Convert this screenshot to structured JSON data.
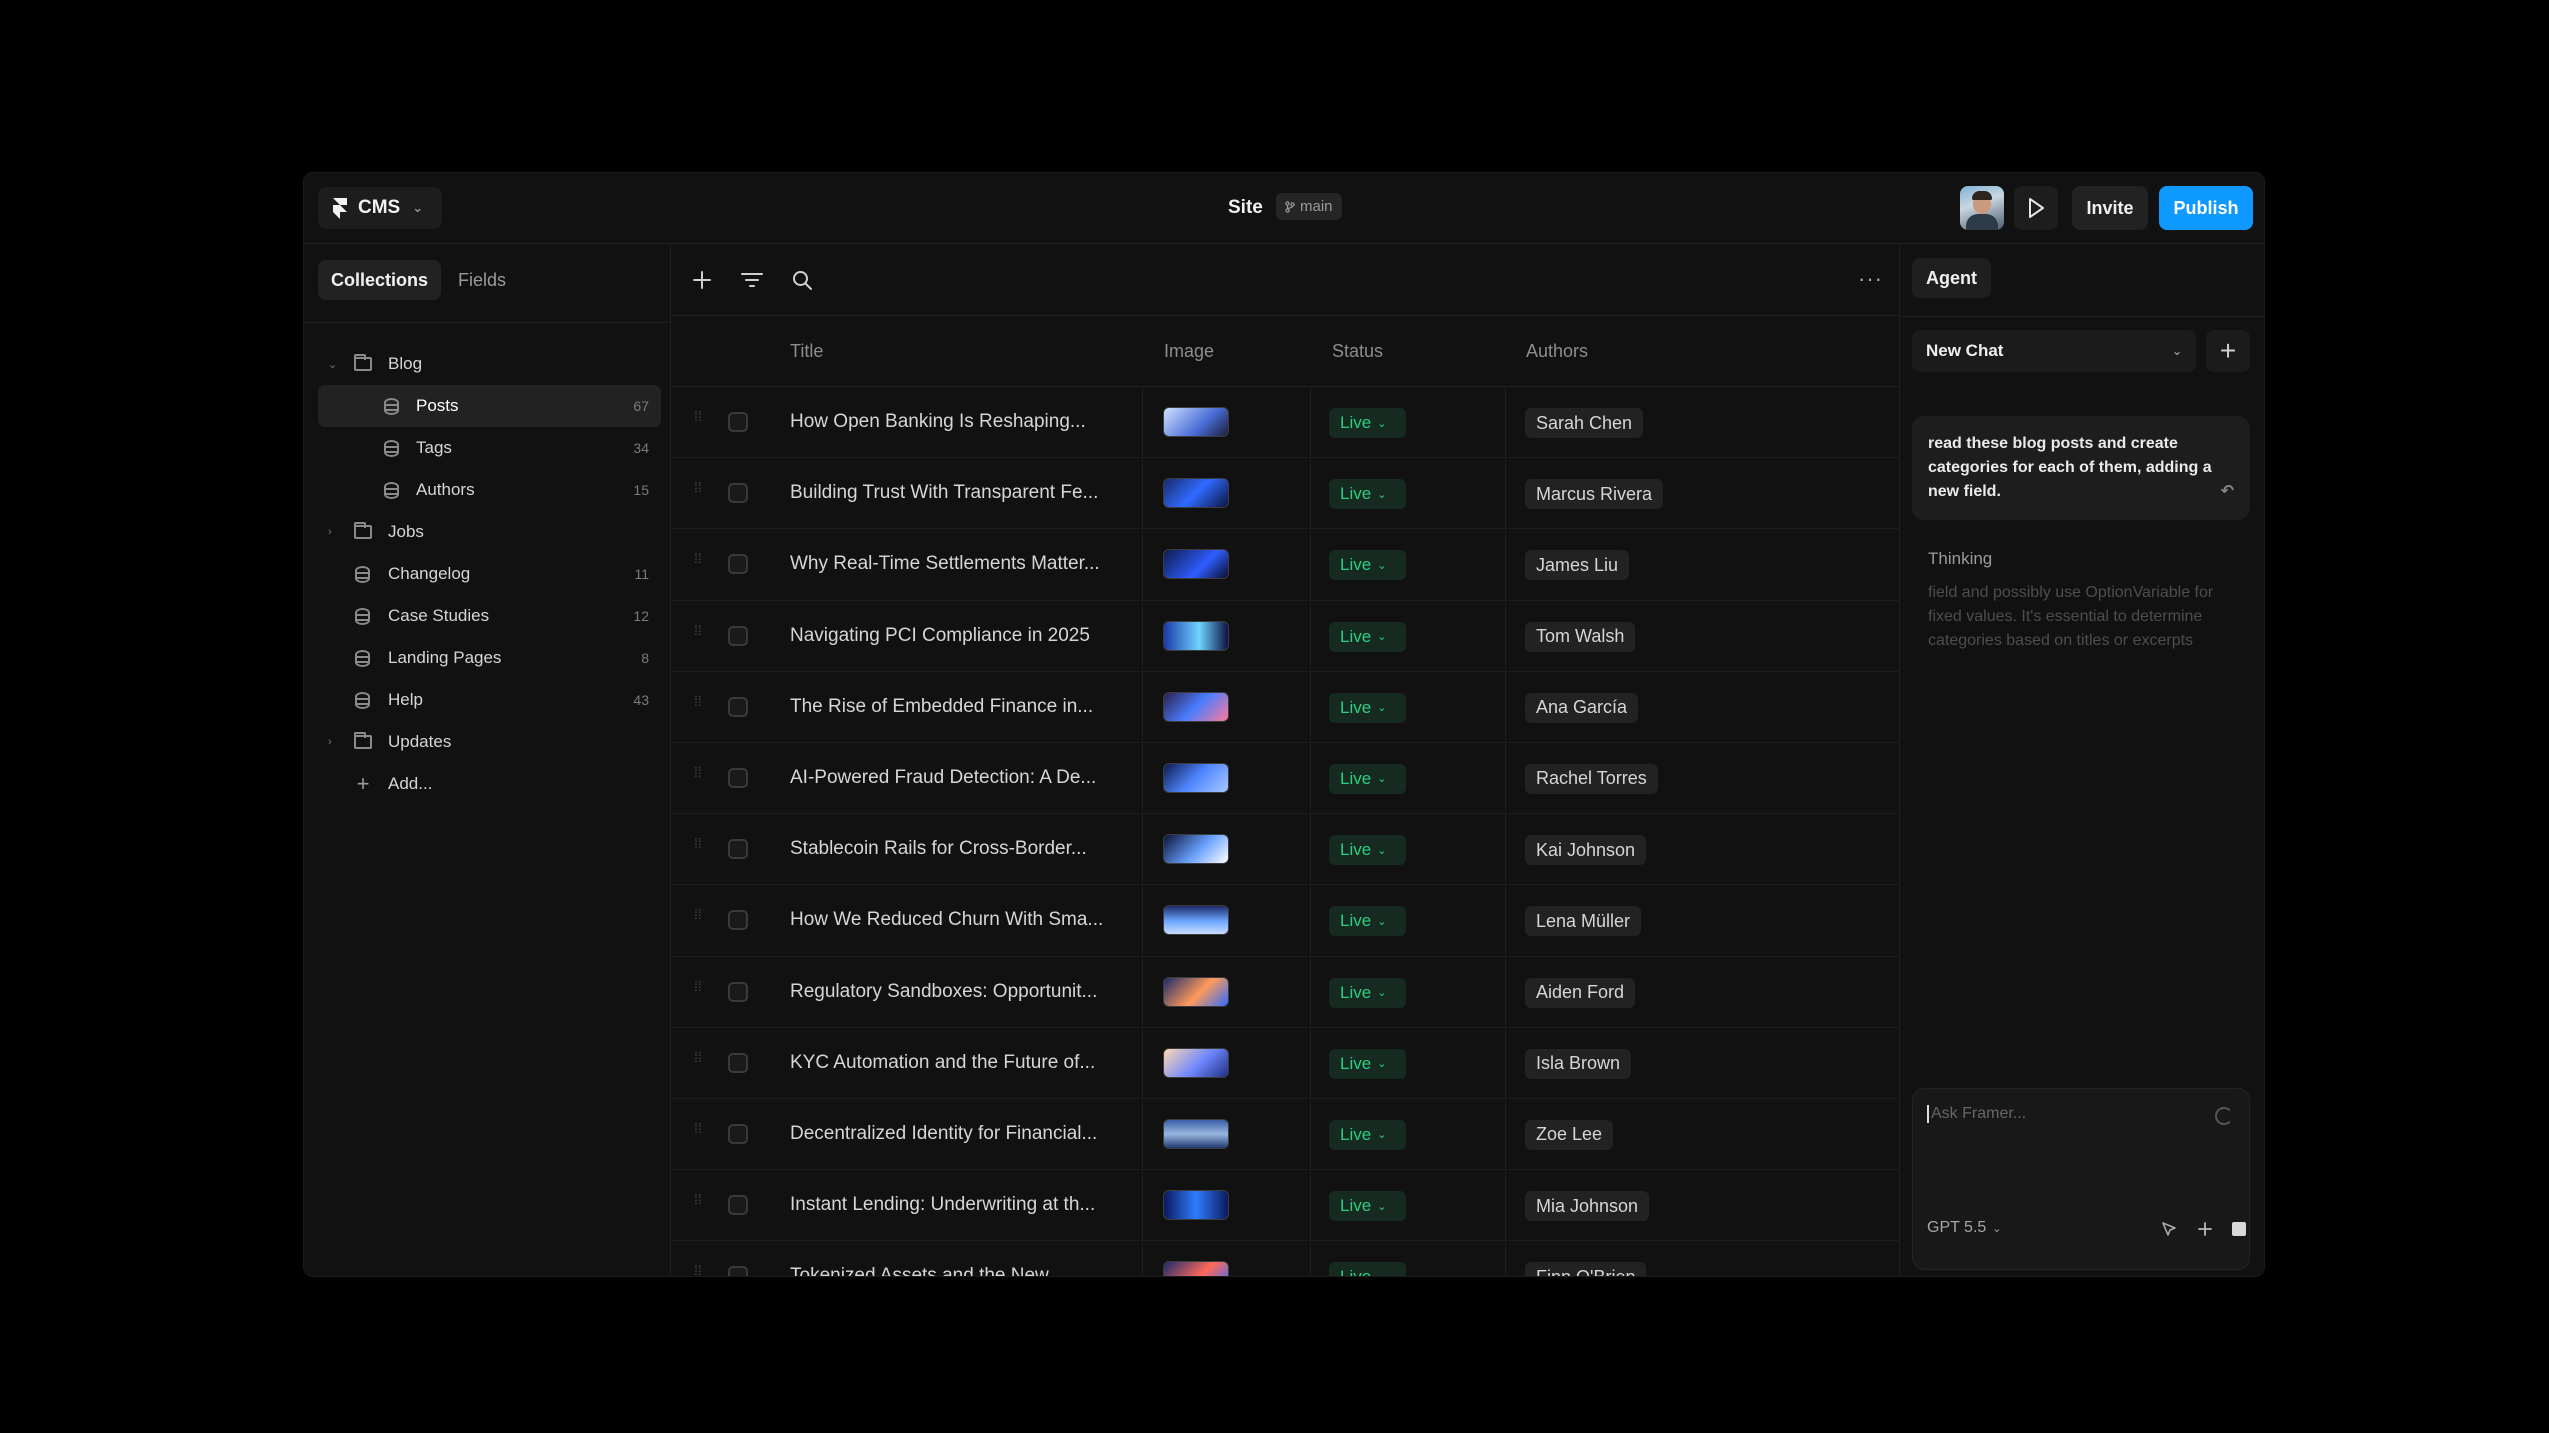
{
  "topbar": {
    "app_label": "CMS",
    "site_title": "Site",
    "branch": "main",
    "invite_label": "Invite",
    "publish_label": "Publish",
    "accent_color": "#0d99ff"
  },
  "sidebar": {
    "tabs": [
      "Collections",
      "Fields"
    ],
    "items": [
      {
        "label": "Blog",
        "count": "",
        "icon": "folder-icon"
      },
      {
        "label": "Posts",
        "count": "67",
        "icon": "database-icon"
      },
      {
        "label": "Tags",
        "count": "34",
        "icon": "database-icon"
      },
      {
        "label": "Authors",
        "count": "15",
        "icon": "database-icon"
      },
      {
        "label": "Jobs",
        "count": "",
        "icon": "folder-icon"
      },
      {
        "label": "Changelog",
        "count": "11",
        "icon": "database-icon"
      },
      {
        "label": "Case Studies",
        "count": "12",
        "icon": "database-icon"
      },
      {
        "label": "Landing Pages",
        "count": "8",
        "icon": "database-icon"
      },
      {
        "label": "Help",
        "count": "43",
        "icon": "database-icon"
      },
      {
        "label": "Updates",
        "count": "",
        "icon": "folder-icon"
      },
      {
        "label": "Add...",
        "count": "",
        "icon": "plus-icon"
      }
    ]
  },
  "table": {
    "columns": [
      "Title",
      "Image",
      "Status",
      "Authors"
    ],
    "status_color": "#2bd07f",
    "rows": [
      {
        "title": "How Open Banking Is Reshaping...",
        "status": "Live",
        "author": "Sarah Chen"
      },
      {
        "title": "Building Trust With Transparent Fe...",
        "status": "Live",
        "author": "Marcus Rivera"
      },
      {
        "title": "Why Real-Time Settlements Matter...",
        "status": "Live",
        "author": "James Liu"
      },
      {
        "title": "Navigating PCI Compliance in 2025",
        "status": "Live",
        "author": "Tom Walsh"
      },
      {
        "title": "The Rise of Embedded Finance in...",
        "status": "Live",
        "author": "Ana García"
      },
      {
        "title": "AI-Powered Fraud Detection: A De...",
        "status": "Live",
        "author": "Rachel Torres"
      },
      {
        "title": "Stablecoin Rails for Cross-Border...",
        "status": "Live",
        "author": "Kai Johnson"
      },
      {
        "title": "How We Reduced Churn With Sma...",
        "status": "Live",
        "author": "Lena Müller"
      },
      {
        "title": "Regulatory Sandboxes: Opportunit...",
        "status": "Live",
        "author": "Aiden Ford"
      },
      {
        "title": "KYC Automation and the Future of...",
        "status": "Live",
        "author": "Isla Brown"
      },
      {
        "title": "Decentralized Identity for Financial...",
        "status": "Live",
        "author": "Zoe Lee"
      },
      {
        "title": "Instant Lending: Underwriting at th...",
        "status": "Live",
        "author": "Mia Johnson"
      },
      {
        "title": "Tokenized Assets and the New...",
        "status": "Live",
        "author": "Finn O'Brien"
      }
    ]
  },
  "agent": {
    "tab_label": "Agent",
    "chat_select": "New Chat",
    "user_message": "read these blog posts and create categories for each of them, adding a new field.",
    "thinking_label": "Thinking",
    "thinking_text": "field and possibly use OptionVariable for fixed values. It's essential to determine categories based on titles or excerpts",
    "input_placeholder": "Ask Framer...",
    "model": "GPT 5.5"
  }
}
